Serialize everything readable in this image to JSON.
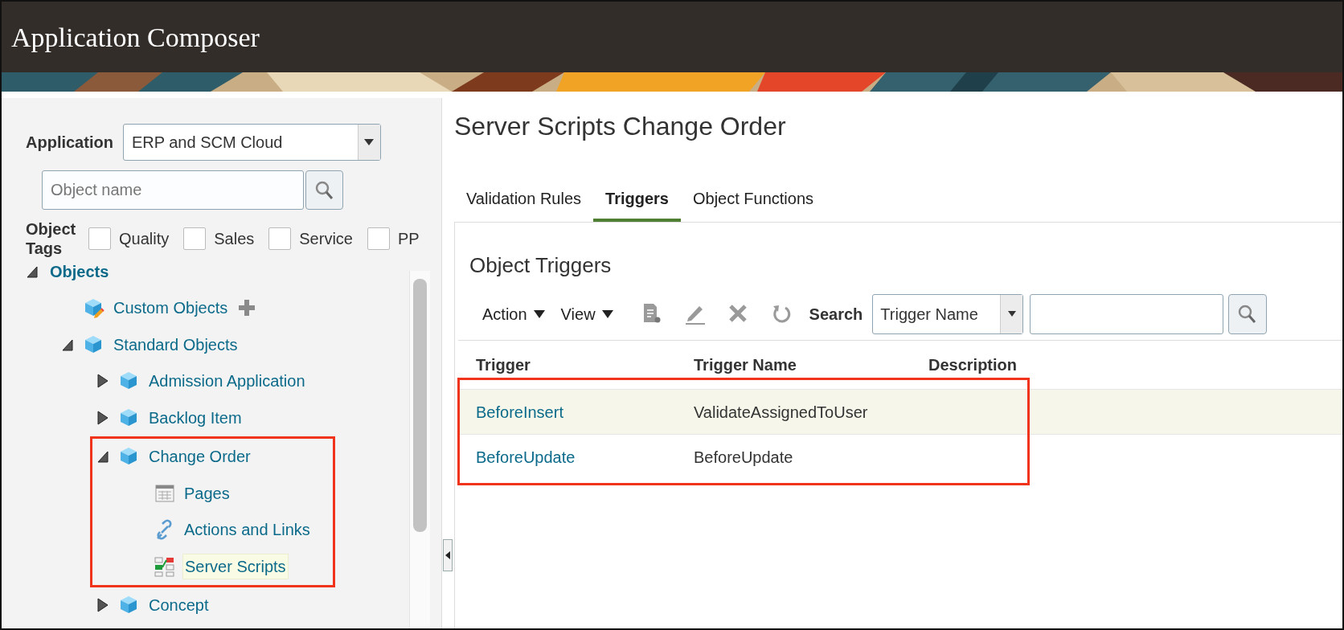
{
  "header": {
    "title": "Application Composer"
  },
  "navigator": {
    "application": {
      "label": "Application",
      "value": "ERP and SCM Cloud"
    },
    "search": {
      "placeholder": "Object name"
    },
    "object_tags": {
      "label": "Object Tags",
      "tags": [
        {
          "label": "Quality",
          "checked": false
        },
        {
          "label": "Sales",
          "checked": false
        },
        {
          "label": "Service",
          "checked": false
        },
        {
          "label": "PP",
          "checked": false
        }
      ]
    },
    "tree": [
      {
        "label": "Objects",
        "kind": "root",
        "expanded": true,
        "selected": false,
        "framed": false,
        "children": [
          {
            "label": "Custom Objects",
            "kind": "custom",
            "selected": false,
            "framed": false
          },
          {
            "label": "Standard Objects",
            "kind": "object",
            "expanded": true,
            "selected": false,
            "framed": false,
            "children": [
              {
                "label": "Admission Application",
                "kind": "object",
                "expanded": false,
                "selected": false,
                "framed": false
              },
              {
                "label": "Backlog Item",
                "kind": "object",
                "expanded": false,
                "selected": false,
                "framed": false
              },
              {
                "label": "Change Order",
                "kind": "object",
                "expanded": true,
                "selected": false,
                "framed": true,
                "children": [
                  {
                    "label": "Pages",
                    "kind": "pages",
                    "selected": false,
                    "framed": false
                  },
                  {
                    "label": "Actions and Links",
                    "kind": "links",
                    "selected": false,
                    "framed": false
                  },
                  {
                    "label": "Server Scripts",
                    "kind": "scripts",
                    "selected": true,
                    "framed": false
                  }
                ]
              },
              {
                "label": "Concept",
                "kind": "object",
                "expanded": false,
                "selected": false,
                "framed": false
              }
            ]
          }
        ]
      }
    ]
  },
  "main": {
    "title": "Server Scripts Change Order",
    "tabs": [
      {
        "label": "Validation Rules",
        "selected": false
      },
      {
        "label": "Triggers",
        "selected": true
      },
      {
        "label": "Object Functions",
        "selected": false
      }
    ],
    "panel": {
      "heading": "Object Triggers",
      "toolbar": {
        "menus": [
          "Action",
          "View"
        ],
        "search_label": "Search",
        "search_by": "Trigger Name"
      },
      "columns": [
        "Trigger",
        "Trigger Name",
        "Description"
      ],
      "rows": [
        {
          "trigger": "BeforeInsert",
          "trigger_name": "ValidateAssignedToUser",
          "selected": true,
          "framed": true
        },
        {
          "trigger": "BeforeUpdate",
          "trigger_name": "BeforeUpdate",
          "selected": false,
          "framed": true
        }
      ]
    }
  }
}
